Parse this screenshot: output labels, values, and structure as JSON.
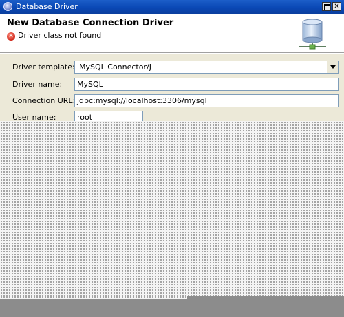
{
  "window": {
    "title": "Database Driver",
    "icon": "app-icon",
    "controls": [
      "maximize-icon",
      "close-icon"
    ]
  },
  "header": {
    "heading": "New Database Connection Driver",
    "message": "Driver class not found",
    "message_icon": "error-icon",
    "banner_icon": "database-icon"
  },
  "form": {
    "template_label": "Driver template:",
    "template_value": "MySQL Connector/J",
    "name_label": "Driver name:",
    "name_value": "MySQL",
    "url_label": "Connection URL:",
    "url_value": "jdbc:mysql://localhost:3306/mysql",
    "user_label": "User name:",
    "user_value": "root"
  },
  "colors": {
    "titlebar": "#0a48b5",
    "panel": "#ece9d8",
    "field_border": "#7f9db9",
    "error": "#d0271a"
  }
}
